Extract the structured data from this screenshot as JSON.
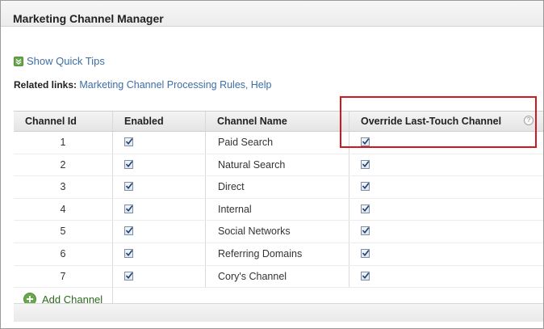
{
  "window": {
    "title": "Marketing Channel Manager"
  },
  "quick_tips": {
    "label": "Show Quick Tips",
    "icon": "chevron-down-icon"
  },
  "related_links": {
    "label": "Related links:",
    "links": [
      {
        "text": "Marketing Channel Processing Rules"
      },
      {
        "text": "Help"
      }
    ],
    "separator": ", "
  },
  "table": {
    "headers": {
      "id": "Channel Id",
      "enabled": "Enabled",
      "name": "Channel Name",
      "override": "Override Last-Touch Channel"
    },
    "help_icon": "question-mark-icon",
    "help_glyph": "?",
    "rows": [
      {
        "id": "1",
        "enabled": true,
        "name": "Paid Search",
        "override": true
      },
      {
        "id": "2",
        "enabled": true,
        "name": "Natural Search",
        "override": true
      },
      {
        "id": "3",
        "enabled": true,
        "name": "Direct",
        "override": true
      },
      {
        "id": "4",
        "enabled": true,
        "name": "Internal",
        "override": true
      },
      {
        "id": "5",
        "enabled": true,
        "name": "Social Networks",
        "override": true
      },
      {
        "id": "6",
        "enabled": true,
        "name": "Referring Domains",
        "override": true
      },
      {
        "id": "7",
        "enabled": true,
        "name": "Cory's Channel",
        "override": true
      }
    ]
  },
  "add_channel": {
    "label": "Add Channel",
    "icon": "plus-circle-icon"
  },
  "colors": {
    "link": "#3d6ea5",
    "add_link": "#2b6a1e",
    "highlight": "#d0191e",
    "plus_green": "#6aa84f"
  }
}
